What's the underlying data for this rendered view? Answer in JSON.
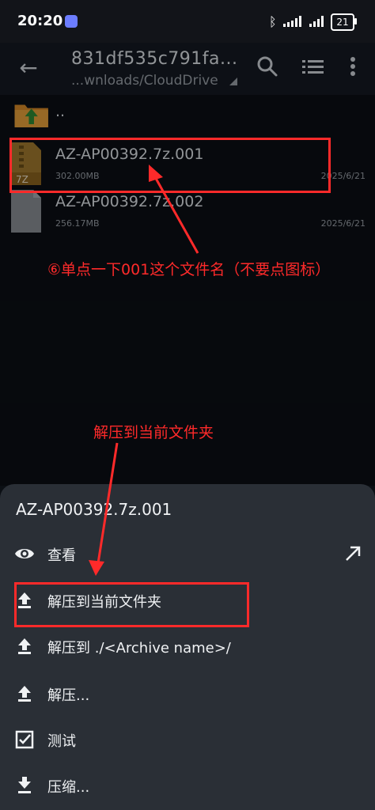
{
  "status_bar": {
    "time": "20:20",
    "battery": "21"
  },
  "toolbar": {
    "title": "831df535c791fa...",
    "subtitle": "...wnloads/CloudDrive"
  },
  "files": [
    {
      "name": "..",
      "size": "",
      "date": ""
    },
    {
      "name": "AZ-AP00392.7z.001",
      "size": "302.00MB",
      "date": "2025/6/21",
      "icon_label": "7Z"
    },
    {
      "name": "AZ-AP00392.7z.002",
      "size": "256.17MB",
      "date": "2025/6/21"
    }
  ],
  "annotations": {
    "step_text": "⑥单点一下001这个文件名（不要点图标）",
    "extract_hint": "解压到当前文件夹"
  },
  "sheet": {
    "title": "AZ-AP00392.7z.001",
    "items": [
      {
        "label": "查看",
        "icon": "eye-icon"
      },
      {
        "label": "解压到当前文件夹",
        "icon": "upload-icon"
      },
      {
        "label": "解压到 ./<Archive name>/",
        "icon": "upload-icon"
      },
      {
        "label": "解压...",
        "icon": "upload-icon"
      },
      {
        "label": "测试",
        "icon": "checkbox-icon"
      },
      {
        "label": "压缩...",
        "icon": "download-icon"
      }
    ]
  },
  "colors": {
    "annotation_red": "#ff2a2a",
    "sheet_background": "#2a2f36",
    "app_background": "#0b0f14",
    "folder_orange": "#d98b28",
    "up_arrow_green": "#2e8b35"
  }
}
